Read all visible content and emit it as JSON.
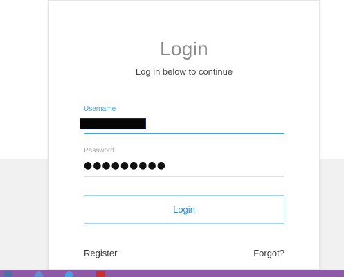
{
  "login": {
    "title": "Login",
    "subtitle": "Log in below to continue",
    "username_label": "Username",
    "password_label": "Password",
    "password_value": "●●●●●●●●●",
    "button_label": "Login",
    "register_label": "Register",
    "forgot_label": "Forgot?"
  },
  "taskbar": {
    "icons": [
      "app-icon",
      "browser-icon",
      "browser-icon",
      "app-icon"
    ]
  },
  "colors": {
    "accent": "#3aa7d8",
    "taskbar": "#8e59a7",
    "button_text": "#2c8fd1"
  }
}
